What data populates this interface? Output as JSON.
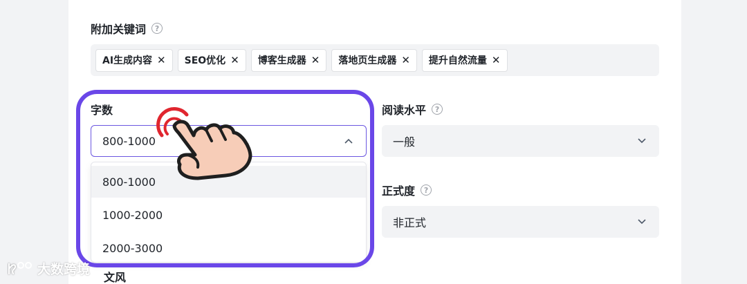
{
  "keywords": {
    "label": "附加关键词",
    "tags": [
      "AI生成内容",
      "SEO优化",
      "博客生成器",
      "落地页生成器",
      "提升自然流量"
    ]
  },
  "word_count": {
    "label": "字数",
    "value": "800-1000",
    "options": [
      "800-1000",
      "1000-2000",
      "2000-3000"
    ],
    "selected_option": "800-1000"
  },
  "reading_level": {
    "label": "阅读水平",
    "value": "一般"
  },
  "formality": {
    "label": "正式度",
    "value": "非正式"
  },
  "partial_label": "文风",
  "watermark": "大数跨境",
  "colors": {
    "accent": "#6a47e8",
    "select_border": "#6b56e0",
    "tap_ring": "#e0262f",
    "hand_fill": "#f7cdb8"
  },
  "icons": [
    "help-icon",
    "close-icon",
    "chevron-up-icon",
    "chevron-down-icon",
    "pointing-hand-icon",
    "logo-icon"
  ]
}
